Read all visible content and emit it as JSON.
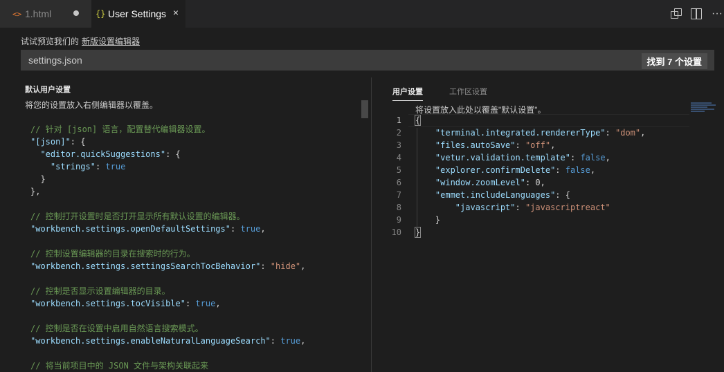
{
  "tabs": [
    {
      "icon": "<>",
      "label": "1.html"
    },
    {
      "icon": "{}",
      "label": "User Settings",
      "close": "×"
    }
  ],
  "actions": {
    "more": "···"
  },
  "preview": {
    "text": "试试预览我们的",
    "link": "新版设置编辑器"
  },
  "search": {
    "value": "settings.json",
    "count": "找到 7 个设置"
  },
  "left": {
    "title": "默认用户设置",
    "desc": "将您的设置放入右侧编辑器以覆盖。",
    "lines": [
      [
        [
          "c-comment",
          "// 针对 [json] 语言，配置替代编辑器设置。"
        ]
      ],
      [
        [
          "c-key",
          "\"[json]\""
        ],
        [
          "c-punc",
          ": {"
        ]
      ],
      [
        [
          "c-punc",
          "  "
        ],
        [
          "c-key",
          "\"editor.quickSuggestions\""
        ],
        [
          "c-punc",
          ": {"
        ]
      ],
      [
        [
          "c-punc",
          "    "
        ],
        [
          "c-key",
          "\"strings\""
        ],
        [
          "c-punc",
          ": "
        ],
        [
          "c-bool",
          "true"
        ]
      ],
      [
        [
          "c-punc",
          "  }"
        ]
      ],
      [
        [
          "c-punc",
          "},"
        ]
      ],
      [],
      [
        [
          "c-comment",
          "// 控制打开设置时是否打开显示所有默认设置的编辑器。"
        ]
      ],
      [
        [
          "c-key",
          "\"workbench.settings.openDefaultSettings\""
        ],
        [
          "c-punc",
          ": "
        ],
        [
          "c-bool",
          "true"
        ],
        [
          "c-punc",
          ","
        ]
      ],
      [],
      [
        [
          "c-comment",
          "// 控制设置编辑器的目录在搜索时的行为。"
        ]
      ],
      [
        [
          "c-key",
          "\"workbench.settings.settingsSearchTocBehavior\""
        ],
        [
          "c-punc",
          ": "
        ],
        [
          "c-str",
          "\"hide\""
        ],
        [
          "c-punc",
          ","
        ]
      ],
      [],
      [
        [
          "c-comment",
          "// 控制是否显示设置编辑器的目录。"
        ]
      ],
      [
        [
          "c-key",
          "\"workbench.settings.tocVisible\""
        ],
        [
          "c-punc",
          ": "
        ],
        [
          "c-bool",
          "true"
        ],
        [
          "c-punc",
          ","
        ]
      ],
      [],
      [
        [
          "c-comment",
          "// 控制是否在设置中启用自然语言搜索模式。"
        ]
      ],
      [
        [
          "c-key",
          "\"workbench.settings.enableNaturalLanguageSearch\""
        ],
        [
          "c-punc",
          ": "
        ],
        [
          "c-bool",
          "true"
        ],
        [
          "c-punc",
          ","
        ]
      ],
      [],
      [
        [
          "c-comment",
          "// 将当前项目中的 JSON 文件与架构关联起来"
        ]
      ]
    ]
  },
  "right": {
    "tabs": {
      "user": "用户设置",
      "workspace": "工作区设置"
    },
    "hint": "将设置放入此处以覆盖\"默认设置\"。",
    "line_numbers": [
      "1",
      "2",
      "3",
      "4",
      "5",
      "6",
      "7",
      "8",
      "9",
      "10"
    ],
    "lines": [
      [
        [
          "c-punc brace-box",
          "{"
        ]
      ],
      [
        [
          "c-punc",
          "    "
        ],
        [
          "c-key",
          "\"terminal.integrated.rendererType\""
        ],
        [
          "c-punc",
          ": "
        ],
        [
          "c-str",
          "\"dom\""
        ],
        [
          "c-punc",
          ","
        ]
      ],
      [
        [
          "c-punc",
          "    "
        ],
        [
          "c-key",
          "\"files.autoSave\""
        ],
        [
          "c-punc",
          ": "
        ],
        [
          "c-str",
          "\"off\""
        ],
        [
          "c-punc",
          ","
        ]
      ],
      [
        [
          "c-punc",
          "    "
        ],
        [
          "c-key",
          "\"vetur.validation.template\""
        ],
        [
          "c-punc",
          ": "
        ],
        [
          "c-bool",
          "false"
        ],
        [
          "c-punc",
          ","
        ]
      ],
      [
        [
          "c-punc",
          "    "
        ],
        [
          "c-key",
          "\"explorer.confirmDelete\""
        ],
        [
          "c-punc",
          ": "
        ],
        [
          "c-bool",
          "false"
        ],
        [
          "c-punc",
          ","
        ]
      ],
      [
        [
          "c-punc",
          "    "
        ],
        [
          "c-key",
          "\"window.zoomLevel\""
        ],
        [
          "c-punc",
          ": 0,"
        ]
      ],
      [
        [
          "c-punc",
          "    "
        ],
        [
          "c-key",
          "\"emmet.includeLanguages\""
        ],
        [
          "c-punc",
          ": {"
        ]
      ],
      [
        [
          "c-punc",
          "        "
        ],
        [
          "c-key",
          "\"javascript\""
        ],
        [
          "c-punc",
          ": "
        ],
        [
          "c-str",
          "\"javascriptreact\""
        ]
      ],
      [
        [
          "c-punc",
          "    }"
        ]
      ],
      [
        [
          "c-punc brace-box",
          "}"
        ]
      ]
    ]
  }
}
